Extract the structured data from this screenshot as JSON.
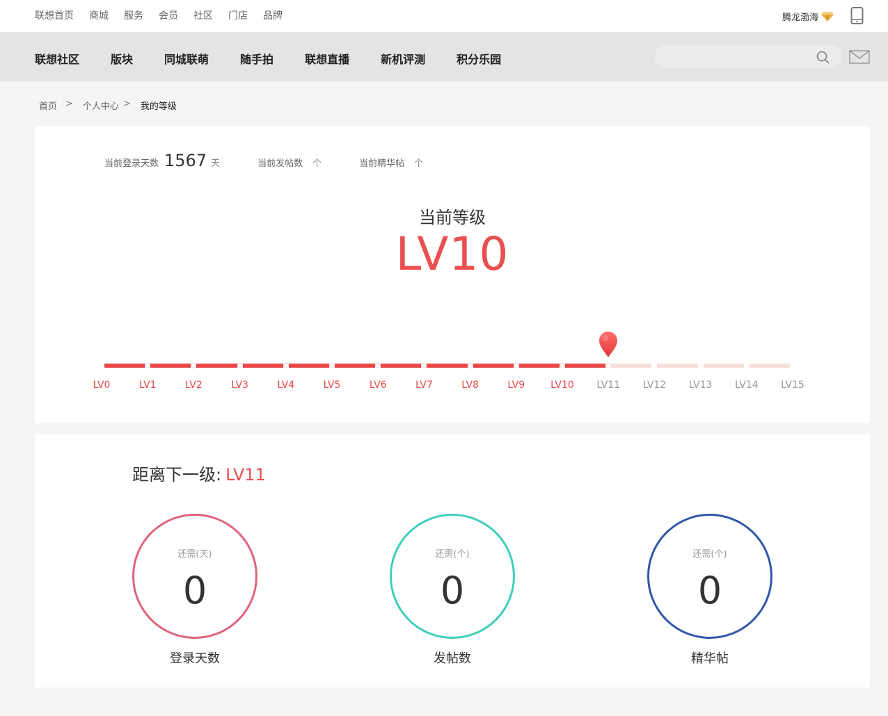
{
  "topbar": {
    "links": [
      "联想首页",
      "商城",
      "服务",
      "会员",
      "社区",
      "门店",
      "品牌"
    ],
    "username": "腾龙渤海"
  },
  "nav": {
    "items": [
      "联想社区",
      "版块",
      "同城联萌",
      "随手拍",
      "联想直播",
      "新机评测",
      "积分乐园"
    ],
    "search_placeholder": ""
  },
  "breadcrumb": {
    "home": "首页",
    "center": "个人中心",
    "current": "我的等级",
    "sep": ">"
  },
  "stats": {
    "login_days_label": "当前登录天数",
    "login_days_value": "1567",
    "login_days_unit": "天",
    "posts_label": "当前发帖数",
    "posts_unit": "个",
    "featured_label": "当前精华帖",
    "featured_unit": "个"
  },
  "level": {
    "title": "当前等级",
    "value": "LV10",
    "levels": [
      "LV0",
      "LV1",
      "LV2",
      "LV3",
      "LV4",
      "LV5",
      "LV6",
      "LV7",
      "LV8",
      "LV9",
      "LV10",
      "LV11",
      "LV12",
      "LV13",
      "LV14",
      "LV15"
    ],
    "progress_reached_index": 11
  },
  "next": {
    "label": "距离下一级:",
    "level": "LV11",
    "cards": [
      {
        "need": "还需(天)",
        "value": "0",
        "caption": "登录天数",
        "color": "#e0637d"
      },
      {
        "need": "还需(个)",
        "value": "0",
        "caption": "发帖数",
        "color": "#3fcfb9"
      },
      {
        "need": "还需(个)",
        "value": "0",
        "caption": "精华帖",
        "color": "#3057a8"
      }
    ]
  },
  "colors": {
    "accent": "#e9504f",
    "track_off": "#f7e0d9"
  }
}
